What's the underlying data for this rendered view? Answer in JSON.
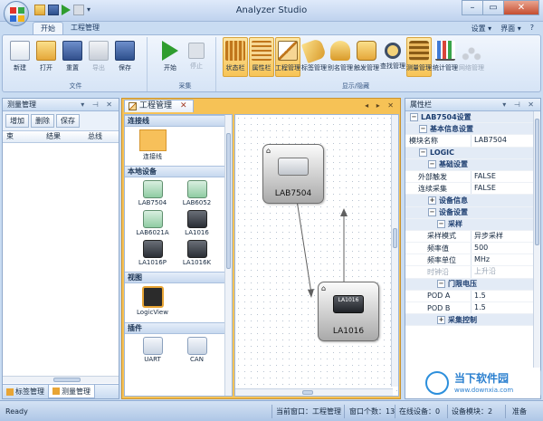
{
  "window": {
    "title": "Analyzer Studio"
  },
  "ribbon": {
    "tabs": [
      "开始",
      "工程管理"
    ],
    "right_tools": [
      "设置 ▾",
      "界面 ▾",
      "?"
    ],
    "groups": [
      {
        "name": "文件",
        "buttons": [
          "新建",
          "打开",
          "重置",
          "导出",
          "保存"
        ]
      },
      {
        "name": "采集",
        "buttons": [
          "开始",
          "停止"
        ]
      },
      {
        "name": "显示/隐藏",
        "buttons": [
          "状态栏",
          "属性栏",
          "工程管理",
          "标签管理",
          "别名管理",
          "触发管理",
          "查找管理",
          "测量管理",
          "统计管理",
          "网络管理"
        ]
      }
    ],
    "selected": [
      "状态栏",
      "属性栏",
      "工程管理",
      "测量管理"
    ],
    "disabled": [
      "导出",
      "停止",
      "网络管理"
    ]
  },
  "left_panel": {
    "title": "测量管理",
    "buttons": [
      "增加",
      "删除",
      "保存"
    ],
    "columns": [
      "束",
      "结果",
      "总线"
    ],
    "bottom_tabs": [
      "标签管理",
      "测量管理"
    ]
  },
  "document": {
    "tab_title": "工程管理",
    "toolbox": {
      "sections": [
        {
          "title": "连接线",
          "items": [
            "连接线"
          ]
        },
        {
          "title": "本地设备",
          "items": [
            "LAB7504",
            "LAB6052",
            "LAB6021A",
            "LA1016",
            "LA1016P",
            "LA1016K"
          ]
        },
        {
          "title": "视图",
          "items": [
            "LogicView"
          ]
        },
        {
          "title": "插件",
          "items": [
            "UART",
            "CAN"
          ]
        }
      ]
    },
    "nodes": [
      {
        "label": "LAB7504"
      },
      {
        "label": "LA1016",
        "badge": "LA1016"
      }
    ]
  },
  "properties": {
    "title": "属性栏",
    "rows": [
      {
        "level": 0,
        "type": "cat",
        "toggle": "−",
        "key": "LAB7504设置"
      },
      {
        "level": 1,
        "type": "cat",
        "toggle": "−",
        "key": "基本信息设置"
      },
      {
        "level": 2,
        "type": "row",
        "key": "模块名称",
        "value": "LAB7504"
      },
      {
        "level": 1,
        "type": "cat",
        "toggle": "−",
        "key": "LOGIC"
      },
      {
        "level": 2,
        "type": "cat",
        "toggle": "−",
        "key": "基础设置"
      },
      {
        "level": 3,
        "type": "row",
        "key": "外部触发",
        "value": "FALSE"
      },
      {
        "level": 3,
        "type": "row",
        "key": "连续采集",
        "value": "FALSE"
      },
      {
        "level": 2,
        "type": "cat",
        "toggle": "+",
        "key": "设备信息"
      },
      {
        "level": 2,
        "type": "cat",
        "toggle": "−",
        "key": "设备设置"
      },
      {
        "level": 3,
        "type": "cat",
        "toggle": "−",
        "key": "采样"
      },
      {
        "level": 4,
        "type": "row",
        "key": "采样模式",
        "value": "异步采样"
      },
      {
        "level": 4,
        "type": "row",
        "key": "频率值",
        "value": "500"
      },
      {
        "level": 4,
        "type": "row",
        "key": "频率单位",
        "value": "MHz"
      },
      {
        "level": 4,
        "type": "row",
        "key": "时钟沿",
        "value": "上升沿",
        "gray": true
      },
      {
        "level": 3,
        "type": "cat",
        "toggle": "−",
        "key": "门限电压"
      },
      {
        "level": 4,
        "type": "row",
        "key": "POD A",
        "value": "1.5"
      },
      {
        "level": 4,
        "type": "row",
        "key": "POD B",
        "value": "1.5"
      },
      {
        "level": 3,
        "type": "cat",
        "toggle": "+",
        "key": "采集控制"
      }
    ]
  },
  "status": {
    "ready": "Ready",
    "current_window": "当前窗口：工程管理",
    "window_count": "窗口个数：13",
    "online_devices": "在线设备：0",
    "device_modules": "设备模块：2",
    "state": "准备"
  },
  "watermark": {
    "brand": "当下软件园",
    "url": "www.downxia.com"
  },
  "colors": {
    "accent": "#f7c456",
    "doc_border": "#f6c256",
    "panel_header": "#c9dbf1"
  }
}
